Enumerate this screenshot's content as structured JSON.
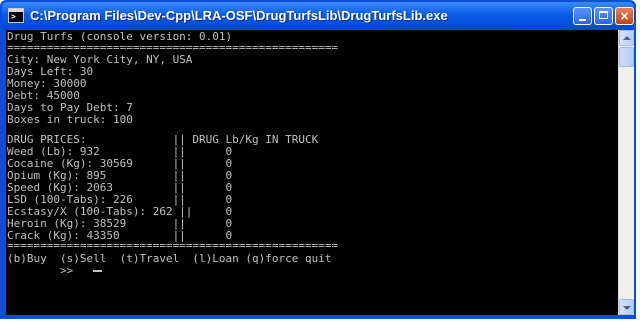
{
  "window": {
    "title": "C:\\Program Files\\Dev-Cpp\\LRA-OSF\\DrugTurfsLib\\DrugTurfsLib.exe",
    "icon": "console-icon",
    "icon_glyph": ">",
    "controls": {
      "minimize": "minimize-icon",
      "maximize": "maximize-icon",
      "close": "×"
    }
  },
  "console": {
    "lines": [
      "Drug Turfs (console version: 0.01)",
      "==================================================",
      "City: New York City, NY, USA",
      "Days Left: 30",
      "Money: 30000",
      "Debt: 45000",
      "Days to Pay Debt: 7",
      "Boxes in truck: 100",
      "",
      "DRUG PRICES:             || DRUG Lb/Kg IN TRUCK",
      "Weed (Lb): 932           ||      0",
      "Cocaine (Kg): 30569      ||      0",
      "Opium (Kg): 895          ||      0",
      "Speed (Kg): 2063         ||      0",
      "LSD (100-Tabs): 226      ||      0",
      "Ecstasy/X (100-Tabs): 262 ||     0",
      "Heroin (Kg): 38529       ||      0",
      "Crack (Kg): 43350        ||      0",
      "==================================================",
      "(b)Buy  (s)Sell  (t)Travel  (l)Loan (q)force quit",
      "        >> "
    ]
  },
  "colors": {
    "console_bg": "#000000",
    "console_text": "#c0c0c0",
    "titlebar": "#0a5ce8",
    "close_button": "#c6401a"
  }
}
